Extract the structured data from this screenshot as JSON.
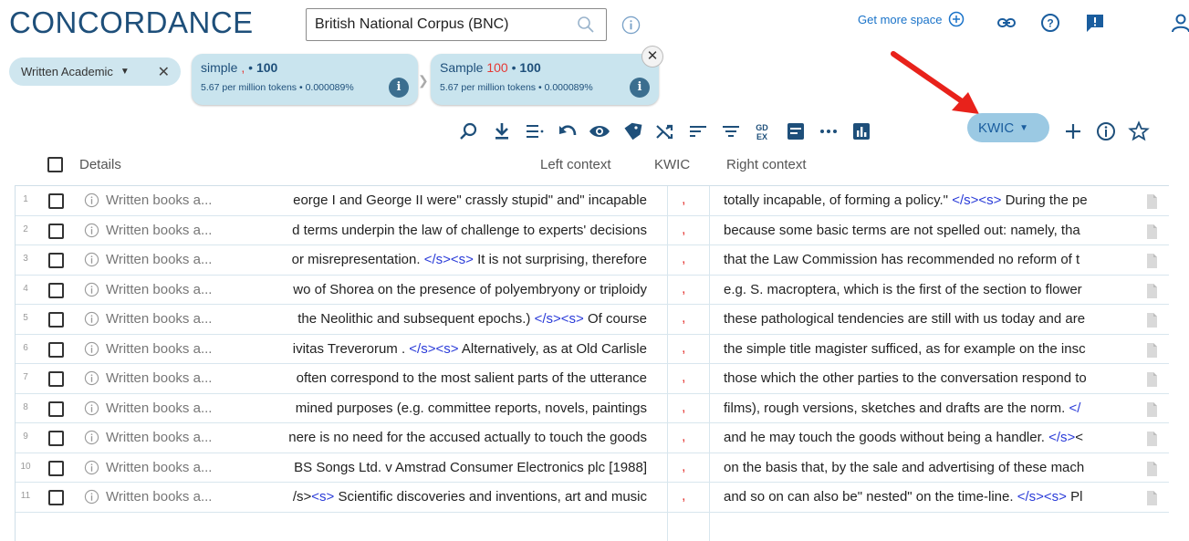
{
  "app": {
    "title": "CONCORDANCE"
  },
  "corpus": {
    "value": "British National Corpus (BNC)"
  },
  "topbar": {
    "get_more_space": "Get more space"
  },
  "filter_chip": {
    "label": "Written Academic"
  },
  "steps": [
    {
      "title_word": "simple",
      "title_sep": ",",
      "count": "100",
      "stats": "5.67 per million tokens • 0.000089%"
    },
    {
      "title_word": "Sample",
      "title_red": "100",
      "count": "100",
      "stats": "5.67 per million tokens • 0.000089%"
    }
  ],
  "toolbar": {
    "kwic_label": "KWIC"
  },
  "columns": {
    "details": "Details",
    "left": "Left context",
    "kwic": "KWIC",
    "right": "Right context"
  },
  "rows": [
    {
      "num": "1",
      "src": "Written books a...",
      "left": "eorge I and George II were\" crassly stupid\" and\" incapable",
      "kwic": ",",
      "right": "totally incapable, of forming a policy.\" </s><s> During the pe"
    },
    {
      "num": "2",
      "src": "Written books a...",
      "left": "d terms underpin the law of challenge to experts' decisions",
      "kwic": ",",
      "right": "because some basic terms are not spelled out: namely, tha"
    },
    {
      "num": "3",
      "src": "Written books a...",
      "left": "or misrepresentation. </s><s> It is not surprising, therefore",
      "kwic": ",",
      "right": "that the Law Commission has recommended no reform of t"
    },
    {
      "num": "4",
      "src": "Written books a...",
      "left": "wo of Shorea on the presence of polyembryony or triploidy",
      "kwic": ",",
      "right": "e.g. S. macroptera, which is the first of the section to flower"
    },
    {
      "num": "5",
      "src": "Written books a...",
      "left": "the Neolithic and subsequent epochs.) </s><s> Of course",
      "kwic": ",",
      "right": "these pathological tendencies are still with us today and are"
    },
    {
      "num": "6",
      "src": "Written books a...",
      "left": "ivitas Treverorum . </s><s> Alternatively, as at Old Carlisle",
      "kwic": ",",
      "right": "the simple title magister sufficed, as for example on the insc"
    },
    {
      "num": "7",
      "src": "Written books a...",
      "left": "often correspond to the most salient parts of the utterance",
      "kwic": ",",
      "right": "those which the other parties to the conversation respond to"
    },
    {
      "num": "8",
      "src": "Written books a...",
      "left": "mined purposes (e.g. committee reports, novels, paintings",
      "kwic": ",",
      "right": "films), rough versions, sketches and drafts are the norm. </"
    },
    {
      "num": "9",
      "src": "Written books a...",
      "left": "nere is no need for the accused actually to touch the goods",
      "kwic": ",",
      "right": "and he may touch the goods without being a handler. </s><"
    },
    {
      "num": "10",
      "src": "Written books a...",
      "left": "BS Songs Ltd. v Amstrad Consumer Electronics plc [1988]",
      "kwic": ",",
      "right": "on the basis that, by the sale and advertising of these mach"
    },
    {
      "num": "11",
      "src": "Written books a...",
      "left": "/s><s> Scientific discoveries and inventions, art and music",
      "kwic": ",",
      "right": "and so on can also be\" nested\" on the time-line. </s><s> Pl"
    }
  ]
}
